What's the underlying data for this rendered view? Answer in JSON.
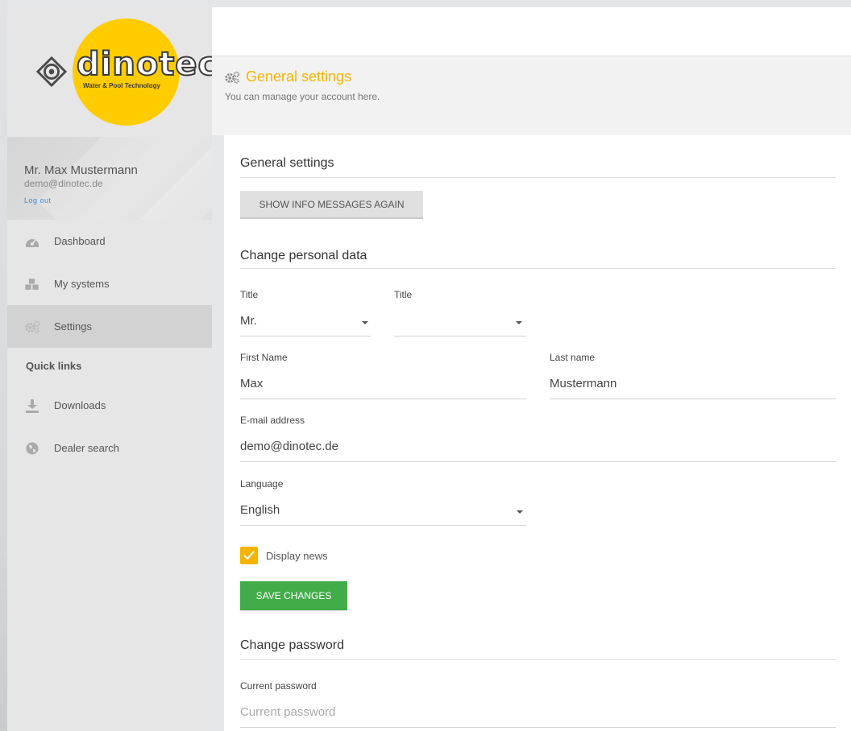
{
  "brand": {
    "logo_text": "dinotec",
    "logo_tagline": "Water & Pool Technology"
  },
  "user": {
    "name": "Mr. Max Mustermann",
    "email": "demo@dinotec.de",
    "logout_label": "Log out"
  },
  "sidebar": {
    "items": [
      {
        "label": "Dashboard",
        "icon": "dashboard-icon"
      },
      {
        "label": "My systems",
        "icon": "cubes-icon"
      },
      {
        "label": "Settings",
        "icon": "gears-icon",
        "active": true
      }
    ],
    "quick_links_title": "Quick links",
    "quick_links": [
      {
        "label": "Downloads",
        "icon": "download-icon"
      },
      {
        "label": "Dealer search",
        "icon": "globe-icon"
      }
    ]
  },
  "header": {
    "title": "General settings",
    "subtitle": "You can manage your account here."
  },
  "general": {
    "title": "General settings",
    "show_info_button": "SHOW INFO MESSAGES AGAIN"
  },
  "personal": {
    "title": "Change personal data",
    "title_label": "Title",
    "title_value": "Mr.",
    "title2_label": "Title",
    "title2_value": "",
    "first_name_label": "First Name",
    "first_name_value": "Max",
    "last_name_label": "Last name",
    "last_name_value": "Mustermann",
    "email_label": "E-mail address",
    "email_value": "demo@dinotec.de",
    "language_label": "Language",
    "language_value": "English",
    "display_news_label": "Display news",
    "display_news_checked": true,
    "save_button": "SAVE CHANGES"
  },
  "password": {
    "title": "Change password",
    "current_label": "Current password",
    "current_placeholder": "Current password"
  },
  "colors": {
    "accent": "#f5b400",
    "save_green": "#43ac4a",
    "logo_yellow": "#ffcc00",
    "link_blue": "#3a8fd8"
  }
}
